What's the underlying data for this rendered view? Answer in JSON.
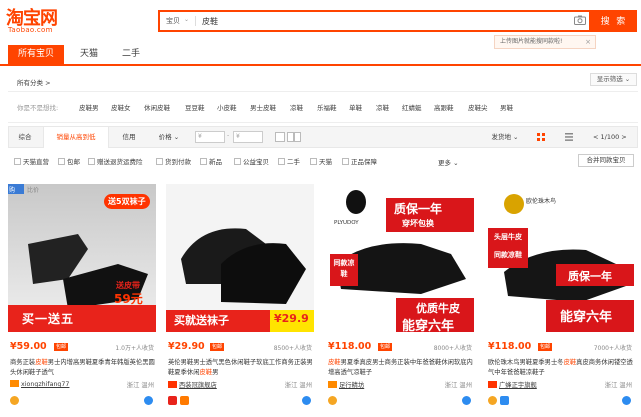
{
  "header": {
    "logo_main": "淘宝网",
    "logo_sub": "Taobao.com",
    "search_category": "宝贝",
    "search_value": "皮鞋",
    "search_button": "搜 索",
    "image_search_tip": "上传图片就能搜同款啦!"
  },
  "tabs": [
    "所有宝贝",
    "天猫",
    "二手"
  ],
  "all_category": "所有分类 >",
  "filter_toggle": "显示筛选 ⌄",
  "related": {
    "label": "你是不是想找:",
    "items": [
      "皮鞋男",
      "皮鞋女",
      "休闲皮鞋",
      "豆豆鞋",
      "小皮鞋",
      "男士皮鞋",
      "凉鞋",
      "乐福鞋",
      "单鞋",
      "凉鞋",
      "红蜻蜓",
      "高跟鞋",
      "皮鞋尖",
      "男鞋"
    ]
  },
  "sort": {
    "items": [
      "综合",
      "销量从高到低",
      "信用",
      "价格 ⌄"
    ],
    "price_from": "¥",
    "price_to": "¥",
    "ship_from": "发货地 ⌄",
    "pager": "< 1/100 >"
  },
  "checkboxes": [
    "天猫直营",
    "包邮",
    "赠送退货运费险",
    "货到付款",
    "新品",
    "公益宝贝",
    "二手",
    "天猫",
    "正品保障"
  ],
  "more": "更多 ⌄",
  "merge_button": "合并同款宝贝",
  "products": [
    {
      "price": "¥59.00",
      "badge": "包邮",
      "sold": "1.0万+人收货",
      "title_pre": "商务正装",
      "title_hl": "皮鞋",
      "title_post": "男士内增高男鞋夏季青年韩版英伦黑圆头休闲鞋子透气",
      "shop": "xiongzhifang77",
      "location": "浙江 温州",
      "img_top": "送5双袜子",
      "img_tag": "送皮带",
      "img_price": "59元",
      "img_bottom": "买一送五",
      "corner_1": "购",
      "corner_2": "比价"
    },
    {
      "price": "¥29.90",
      "badge": "包邮",
      "sold": "8500+人收货",
      "title_pre": "英伦男鞋男士透气黑色休闲鞋子软底工作商务正装男鞋夏季休闲",
      "title_hl": "皮鞋",
      "title_post": "男",
      "shop": "西装冠旗舰店",
      "location": "浙江 温州",
      "img_bottom": "买就送袜子",
      "img_price": "¥29.9"
    },
    {
      "price": "¥118.00",
      "badge": "包邮",
      "sold": "8000+人收货",
      "title_pre": "",
      "title_hl": "皮鞋",
      "title_post": "男夏季真皮男士商务正装中年爸爸鞋休闲软底内增高透气凉鞋子",
      "shop": "足行精坊",
      "location": "浙江 温州",
      "img_brand": "PLYUDOY",
      "img_banner": "质保一年",
      "img_sub": "穿坏包换",
      "img_tag": "同款凉鞋",
      "img_bottom1": "优质牛皮",
      "img_bottom2": "能穿六年"
    },
    {
      "price": "¥118.00",
      "badge": "包邮",
      "sold": "7000+人收货",
      "title_pre": "欧伦珠木鸟男鞋夏季男士冬",
      "title_hl": "皮鞋",
      "title_post": "真皮商务休闲镂空透气中年爸爸鞋凉鞋子",
      "shop": "广蜂正宇旗舰",
      "location": "浙江 温州",
      "img_brand": "欧伦珠木鸟",
      "img_tag": "头层牛皮",
      "img_tag2": "同款凉鞋",
      "img_banner": "质保一年",
      "img_bottom": "能穿六年"
    }
  ],
  "colors": {
    "accent": "#ff4400",
    "sold_text": "#888888",
    "border": "#e8e8e8"
  }
}
